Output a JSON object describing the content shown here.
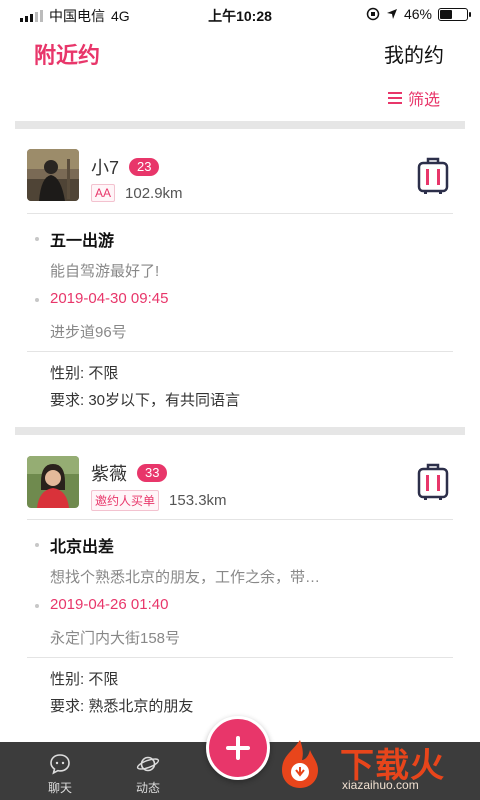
{
  "status": {
    "carrier": "中国电信",
    "network": "4G",
    "time": "上午10:28",
    "battery_text": "46%",
    "battery_level": 0.46
  },
  "header": {
    "left_title": "附近约",
    "right_title": "我的约",
    "filter_label": "筛选"
  },
  "cards": [
    {
      "name": "小7",
      "age": "23",
      "tag": "AA",
      "distance": "102.9km",
      "title": "五一出游",
      "desc": "能自驾游最好了!",
      "datetime": "2019-04-30 09:45",
      "location": "进步道96号",
      "gender": "性别: 不限",
      "requirement": "要求: 30岁以下，有共同语言"
    },
    {
      "name": "紫薇",
      "age": "33",
      "tag": "邀约人买单",
      "distance": "153.3km",
      "title": "北京出差",
      "desc": "想找个熟悉北京的朋友，工作之余，带…",
      "datetime": "2019-04-26 01:40",
      "location": "永定门内大街158号",
      "gender": "性别: 不限",
      "requirement": "要求: 熟悉北京的朋友"
    }
  ],
  "tabs": [
    {
      "label": "聊天",
      "icon": "chat-icon"
    },
    {
      "label": "动态",
      "icon": "planet-icon"
    }
  ],
  "watermark": {
    "text": "下载火",
    "url": "xiazaihuo.com"
  },
  "colors": {
    "accent": "#e8366a",
    "bottom_bar": "#3c3c3c"
  }
}
